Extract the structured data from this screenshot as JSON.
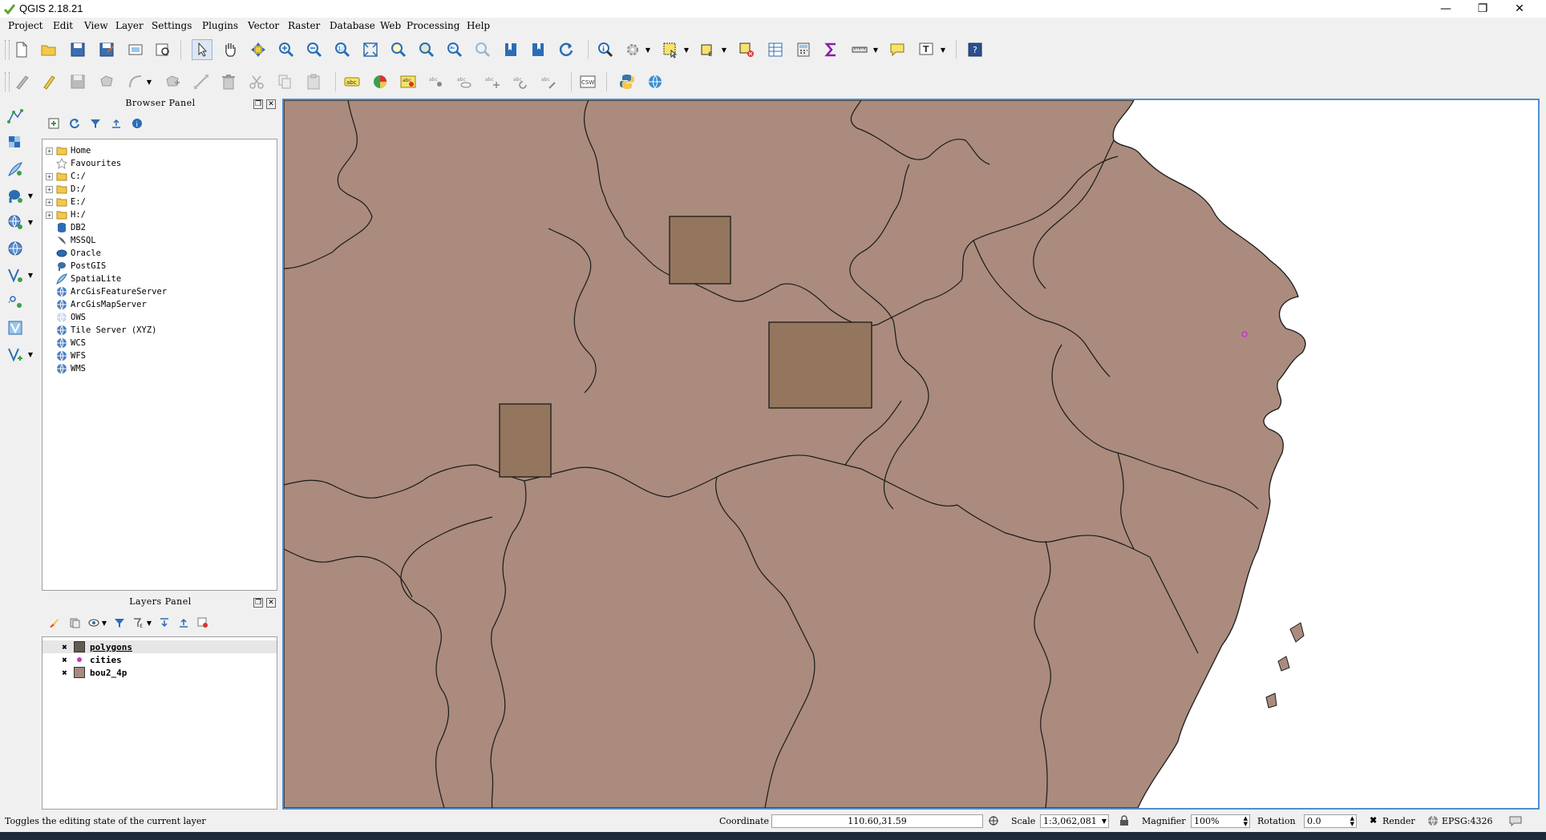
{
  "window": {
    "title": "QGIS 2.18.21",
    "minimize_glyph": "—",
    "restore_glyph": "❐",
    "close_glyph": "✕"
  },
  "menu": [
    "Project",
    "Edit",
    "View",
    "Layer",
    "Settings",
    "Plugins",
    "Vector",
    "Raster",
    "Database",
    "Web",
    "Processing",
    "Help"
  ],
  "browser_panel": {
    "title": "Browser Panel",
    "items": [
      {
        "label": "Home",
        "icon": "folder-icon",
        "expandable": true
      },
      {
        "label": "Favourites",
        "icon": "star-icon",
        "expandable": false
      },
      {
        "label": "C:/",
        "icon": "folder-icon",
        "expandable": true
      },
      {
        "label": "D:/",
        "icon": "folder-icon",
        "expandable": true
      },
      {
        "label": "E:/",
        "icon": "folder-icon",
        "expandable": true
      },
      {
        "label": "H:/",
        "icon": "folder-icon",
        "expandable": true
      },
      {
        "label": "DB2",
        "icon": "database-icon",
        "expandable": false
      },
      {
        "label": "MSSQL",
        "icon": "mssql-icon",
        "expandable": false
      },
      {
        "label": "Oracle",
        "icon": "database-icon",
        "expandable": false
      },
      {
        "label": "PostGIS",
        "icon": "elephant-icon",
        "expandable": false
      },
      {
        "label": "SpatiaLite",
        "icon": "feather-icon",
        "expandable": false
      },
      {
        "label": "ArcGisFeatureServer",
        "icon": "globe-icon",
        "expandable": false
      },
      {
        "label": "ArcGisMapServer",
        "icon": "globe-icon",
        "expandable": false
      },
      {
        "label": "OWS",
        "icon": "globe-icon",
        "expandable": false
      },
      {
        "label": "Tile Server (XYZ)",
        "icon": "globe-icon",
        "expandable": false
      },
      {
        "label": "WCS",
        "icon": "globe-icon",
        "expandable": false
      },
      {
        "label": "WFS",
        "icon": "globe-icon",
        "expandable": false
      },
      {
        "label": "WMS",
        "icon": "globe-icon",
        "expandable": false
      }
    ]
  },
  "layers_panel": {
    "title": "Layers Panel",
    "layers": [
      {
        "name": "polygons",
        "checked": true,
        "symbol": "polygon-fill",
        "color": "#645a50",
        "selected": true
      },
      {
        "name": "cities",
        "checked": true,
        "symbol": "point",
        "color": "#c837c8",
        "selected": false
      },
      {
        "name": "bou2_4p",
        "checked": true,
        "symbol": "polygon-fill",
        "color": "#a88a7e",
        "selected": false
      }
    ]
  },
  "map": {
    "province_fill": "#aa8b7d",
    "rect_fill": "#93765d",
    "outline": "#1a1a1a",
    "sea": "#ffffff",
    "city_point_color": "#c837c8"
  },
  "status": {
    "message": "Toggles the editing state of the current layer",
    "coordinate_label": "Coordinate",
    "coordinate_value": "110.60,31.59",
    "scale_label": "Scale",
    "scale_value": "1:3,062,081",
    "magnifier_label": "Magnifier",
    "magnifier_value": "100%",
    "rotation_label": "Rotation",
    "rotation_value": "0.0",
    "render_label": "Render",
    "crs": "EPSG:4326"
  }
}
